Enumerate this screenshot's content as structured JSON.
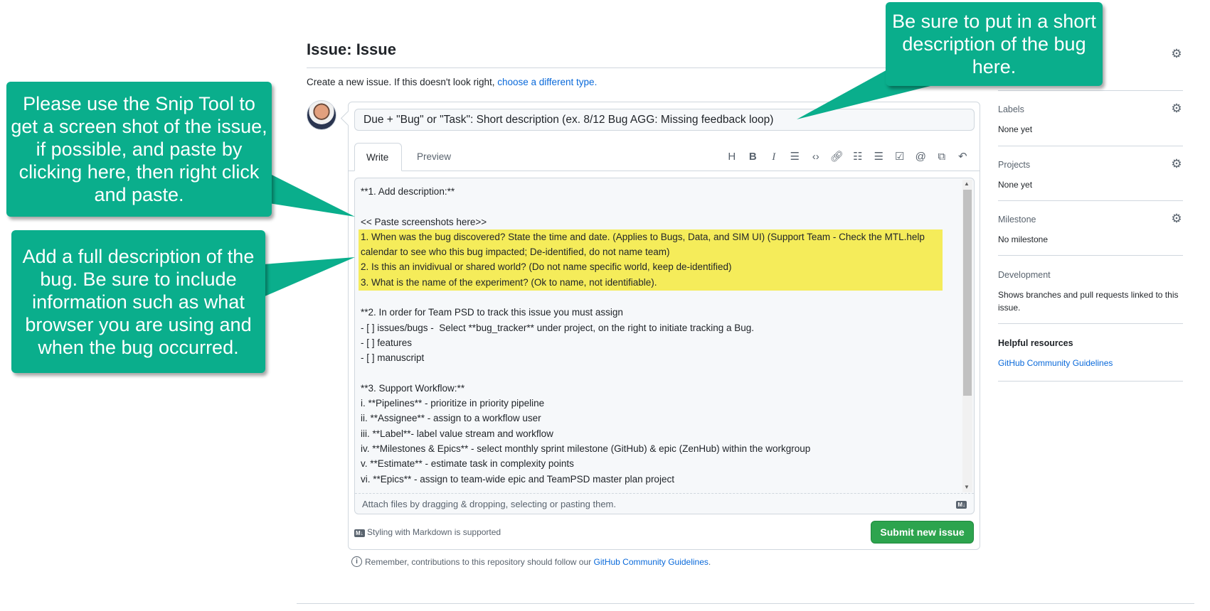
{
  "header": {
    "title": "Issue: Issue",
    "subtitle": "Create a new issue. If this doesn't look right, ",
    "subtitle_link": "choose a different type."
  },
  "form": {
    "title_value": "Due + \"Bug\" or \"Task\": Short description (ex. 8/12 Bug AGG: Missing feedback loop)",
    "tabs": [
      "Write",
      "Preview"
    ],
    "toolbar_icons": [
      "heading-icon",
      "bold-icon",
      "italic-icon",
      "quote-icon",
      "code-icon",
      "link-icon",
      "bulleted-list-icon",
      "numbered-list-icon",
      "task-list-icon",
      "mention-icon",
      "reference-icon",
      "undo-icon"
    ],
    "body_text": "**1. Add description:**\n\n<< Paste screenshots here>>\n1. When was the bug discovered? State the time and date. (Applies to Bugs, Data, and SIM UI) (Support Team - Check the MTL.help\ncalendar to see who this bug impacted; De-identified, do not name team)\n2. Is this an invidivual or shared world? (Do not name specific world, keep de-identified)\n3. What is the name of the experiment? (Ok to name, not identifiable).\n\n**2. In order for Team PSD to track this issue you must assign\n- [ ] issues/bugs -  Select **bug_tracker** under project, on the right to initiate tracking a Bug.\n- [ ] features\n- [ ] manuscript\n\n**3. Support Workflow:**\ni. **Pipelines** - prioritize in priority pipeline\nii. **Assignee** - assign to a workflow user\niii. **Label**- label value stream and workflow\niv. **Milestones & Epics** - select monthly sprint milestone (GitHub) & epic (ZenHub) within the workgroup\nv. **Estimate** - estimate task in complexity points\nvi. **Epics** - assign to team-wide epic and TeamPSD master plan project",
    "attach_text": "Attach files by dragging & dropping, selecting or pasting them.",
    "markdown_badge": "M↓",
    "markdown_note": "Styling with Markdown is supported",
    "submit_label": "Submit new issue",
    "remember_text": "Remember, contributions to this repository should follow our ",
    "remember_link": "GitHub Community Guidelines",
    "remember_end": "."
  },
  "sidebar": {
    "labels": {
      "heading": "Labels",
      "value": "None yet"
    },
    "projects": {
      "heading": "Projects",
      "value": "None yet"
    },
    "milestone": {
      "heading": "Milestone",
      "value": "No milestone"
    },
    "development": {
      "heading": "Development",
      "value": "Shows branches and pull requests linked to this issue."
    },
    "helpful": {
      "heading": "Helpful resources",
      "link": "GitHub Community Guidelines"
    }
  },
  "callouts": {
    "title_tip": "Be sure to put in a short description of the bug here.",
    "snip_tip": "Please use the Snip Tool to get a screen shot of the issue, if possible, and paste by clicking here, then right click and paste.",
    "description_tip": "Add a full description of the bug. Be sure to include information such as what browser you are using and when the bug occurred."
  },
  "colors": {
    "callout": "#0aae8c",
    "highlight": "#f5ec5a",
    "submit": "#2da44e",
    "link": "#0969da"
  }
}
